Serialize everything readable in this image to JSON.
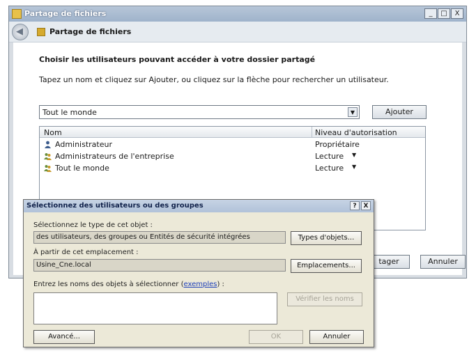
{
  "main_window": {
    "title": "Partage de fichiers",
    "nav_title": "Partage de fichiers",
    "controls": {
      "minimize": "_",
      "maximize": "□",
      "close": "X"
    }
  },
  "sharing": {
    "heading": "Choisir les utilisateurs pouvant accéder à votre dossier partagé",
    "instructions": "Tapez un nom et cliquez sur Ajouter, ou cliquez sur la flèche pour rechercher un utilisateur.",
    "combo_value": "Tout le monde",
    "add_button": "Ajouter",
    "table": {
      "headers": {
        "name": "Nom",
        "level": "Niveau d'autorisation"
      },
      "rows": [
        {
          "name": "Administrateur",
          "level": "Propriétaire",
          "icon": "user-icon",
          "has_dropdown": false
        },
        {
          "name": "Administrateurs de l'entreprise",
          "level": "Lecture",
          "icon": "group-icon",
          "has_dropdown": true
        },
        {
          "name": "Tout le monde",
          "level": "Lecture",
          "icon": "group-icon",
          "has_dropdown": true
        }
      ]
    },
    "share_button": "tager",
    "cancel_button": "Annuler"
  },
  "dialog": {
    "title": "Sélectionnez des utilisateurs ou des groupes",
    "help_button": "?",
    "close_button": "X",
    "object_type_label": "Sélectionnez le type de cet objet :",
    "object_type_value": "des utilisateurs, des groupes ou Entités de sécurité intégrées",
    "object_types_button": "Types d'objets...",
    "location_label": "À partir de cet emplacement :",
    "location_value": "Usine_Cne.local",
    "locations_button": "Emplacements...",
    "names_label_prefix": "Entrez les noms des objets à sélectionner (",
    "names_label_link": "exemples",
    "names_label_suffix": ") :",
    "names_value": "",
    "check_names_button": "Vérifier les noms",
    "advanced_button": "Avancé...",
    "ok_button": "OK",
    "cancel_button": "Annuler"
  },
  "colors": {
    "title_bar": "#9fb3cb",
    "dialog_face": "#ece9d8",
    "link": "#1d3fb8"
  }
}
